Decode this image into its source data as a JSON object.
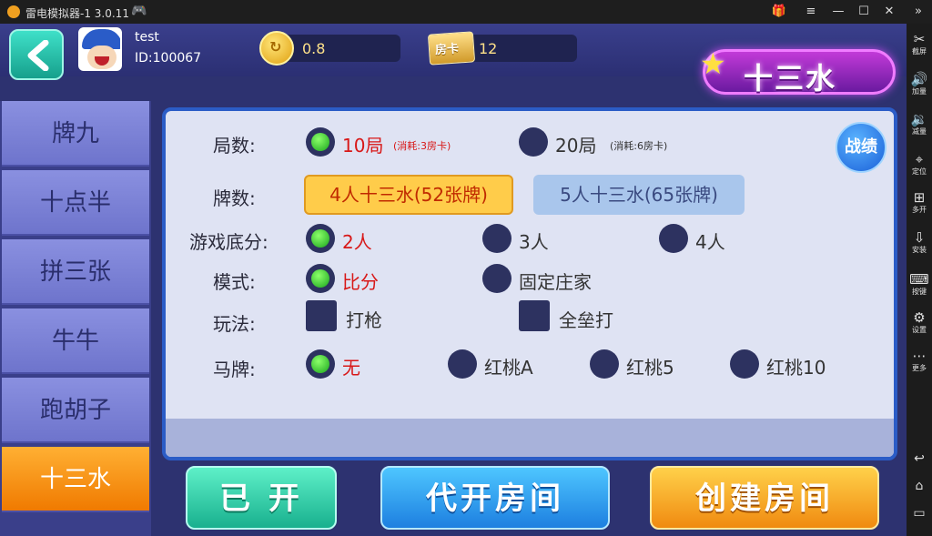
{
  "window": {
    "title": "雷电模拟器-1 3.0.11"
  },
  "toolbar": {
    "items": [
      {
        "icon": "scissors-icon",
        "label": "截屏"
      },
      {
        "icon": "volume-up-icon",
        "label": "加量"
      },
      {
        "icon": "volume-down-icon",
        "label": "减量"
      },
      {
        "icon": "location-icon",
        "label": "定位"
      },
      {
        "icon": "multi-window-icon",
        "label": "多开"
      },
      {
        "icon": "apk-install-icon",
        "label": "安装"
      },
      {
        "icon": "keyboard-icon",
        "label": "按键"
      },
      {
        "icon": "settings-icon",
        "label": "设置"
      },
      {
        "icon": "more-icon",
        "label": "更多"
      }
    ]
  },
  "user": {
    "name": "test",
    "id": "ID:100067"
  },
  "currency": {
    "coins": "0.8",
    "card_icon_label": "房卡",
    "room_cards": "12"
  },
  "game_logo": "十三水",
  "sidebar": {
    "items": [
      {
        "label": "牌九"
      },
      {
        "label": "十点半"
      },
      {
        "label": "拼三张"
      },
      {
        "label": "牛牛"
      },
      {
        "label": "跑胡子"
      },
      {
        "label": "十三水",
        "active": true
      }
    ]
  },
  "form": {
    "record_button": "战绩",
    "rounds": {
      "label": "局数:",
      "options": [
        {
          "text": "10局",
          "note": "(消耗:3房卡)",
          "selected": true
        },
        {
          "text": "20局",
          "note": "(消耗:6房卡)",
          "selected": false
        }
      ]
    },
    "cards": {
      "label": "牌数:",
      "options": [
        {
          "text": "4人十三水(52张牌)",
          "selected": true
        },
        {
          "text": "5人十三水(65张牌)",
          "selected": false
        }
      ]
    },
    "base_score": {
      "label": "游戏底分:",
      "options": [
        {
          "text": "2人",
          "selected": true
        },
        {
          "text": "3人",
          "selected": false
        },
        {
          "text": "4人",
          "selected": false
        }
      ]
    },
    "mode": {
      "label": "模式:",
      "options": [
        {
          "text": "比分",
          "selected": true
        },
        {
          "text": "固定庄家",
          "selected": false
        }
      ]
    },
    "play": {
      "label": "玩法:",
      "options": [
        {
          "text": "打枪",
          "checked": false
        },
        {
          "text": "全垒打",
          "checked": false
        }
      ]
    },
    "horse": {
      "label": "马牌:",
      "options": [
        {
          "text": "无",
          "selected": true
        },
        {
          "text": "红桃A",
          "selected": false
        },
        {
          "text": "红桃5",
          "selected": false
        },
        {
          "text": "红桃10",
          "selected": false
        }
      ]
    }
  },
  "actions": {
    "opened": "已 开",
    "proxy_open": "代开房间",
    "create": "创建房间"
  },
  "colors": {
    "selected_text": "#d81818",
    "panel_border": "#2b5cc6",
    "sidebar_active": "#f07a00"
  }
}
